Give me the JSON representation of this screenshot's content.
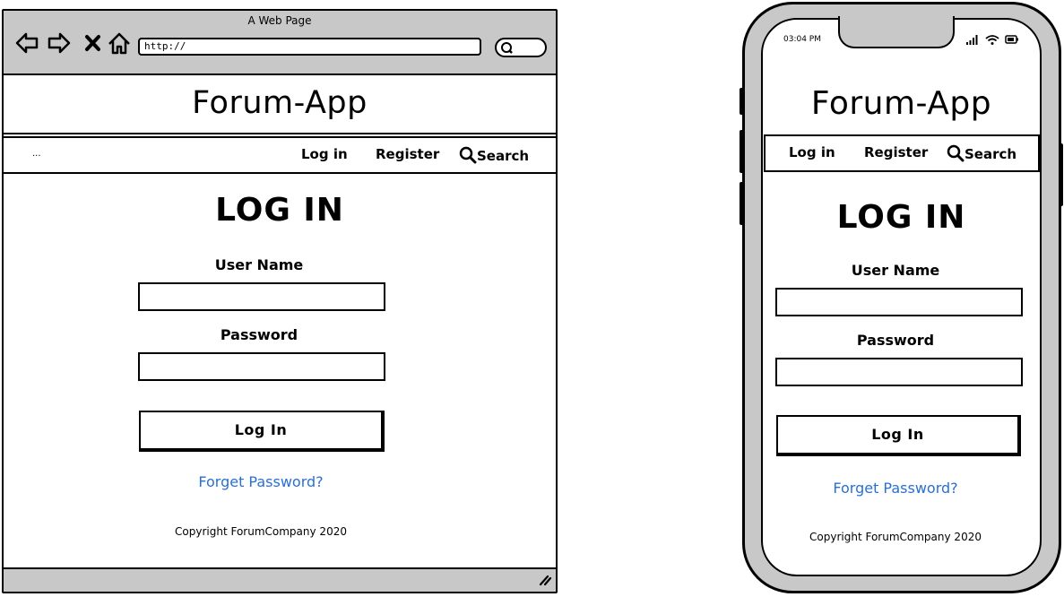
{
  "browser": {
    "window_title": "A Web Page",
    "url": "http://",
    "nav_icons": [
      "back-arrow-icon",
      "forward-arrow-icon",
      "close-x-icon",
      "home-icon"
    ],
    "app_title": "Forum-App",
    "nav": {
      "ellipsis": "...",
      "login": "Log in",
      "register": "Register",
      "search": "Search"
    },
    "heading": "LOG IN",
    "username_label": "User Name",
    "password_label": "Password",
    "login_button": "Log In",
    "forgot_password": "Forget Password?",
    "copyright": "Copyright ForumCompany 2020"
  },
  "phone": {
    "status_time": "03:04 PM",
    "status_icons": [
      "signal-bars-icon",
      "wifi-icon",
      "battery-icon"
    ],
    "app_title": "Forum-App",
    "nav": {
      "login": "Log in",
      "register": "Register",
      "search": "Search"
    },
    "heading": "LOG IN",
    "username_label": "User Name",
    "password_label": "Password",
    "login_button": "Log In",
    "forgot_password": "Forget Password?",
    "copyright": "Copyright ForumCompany 2020"
  },
  "colors": {
    "chrome_gray": "#c8c8c8",
    "link_blue": "#2a6fd4",
    "outline": "#000000"
  }
}
